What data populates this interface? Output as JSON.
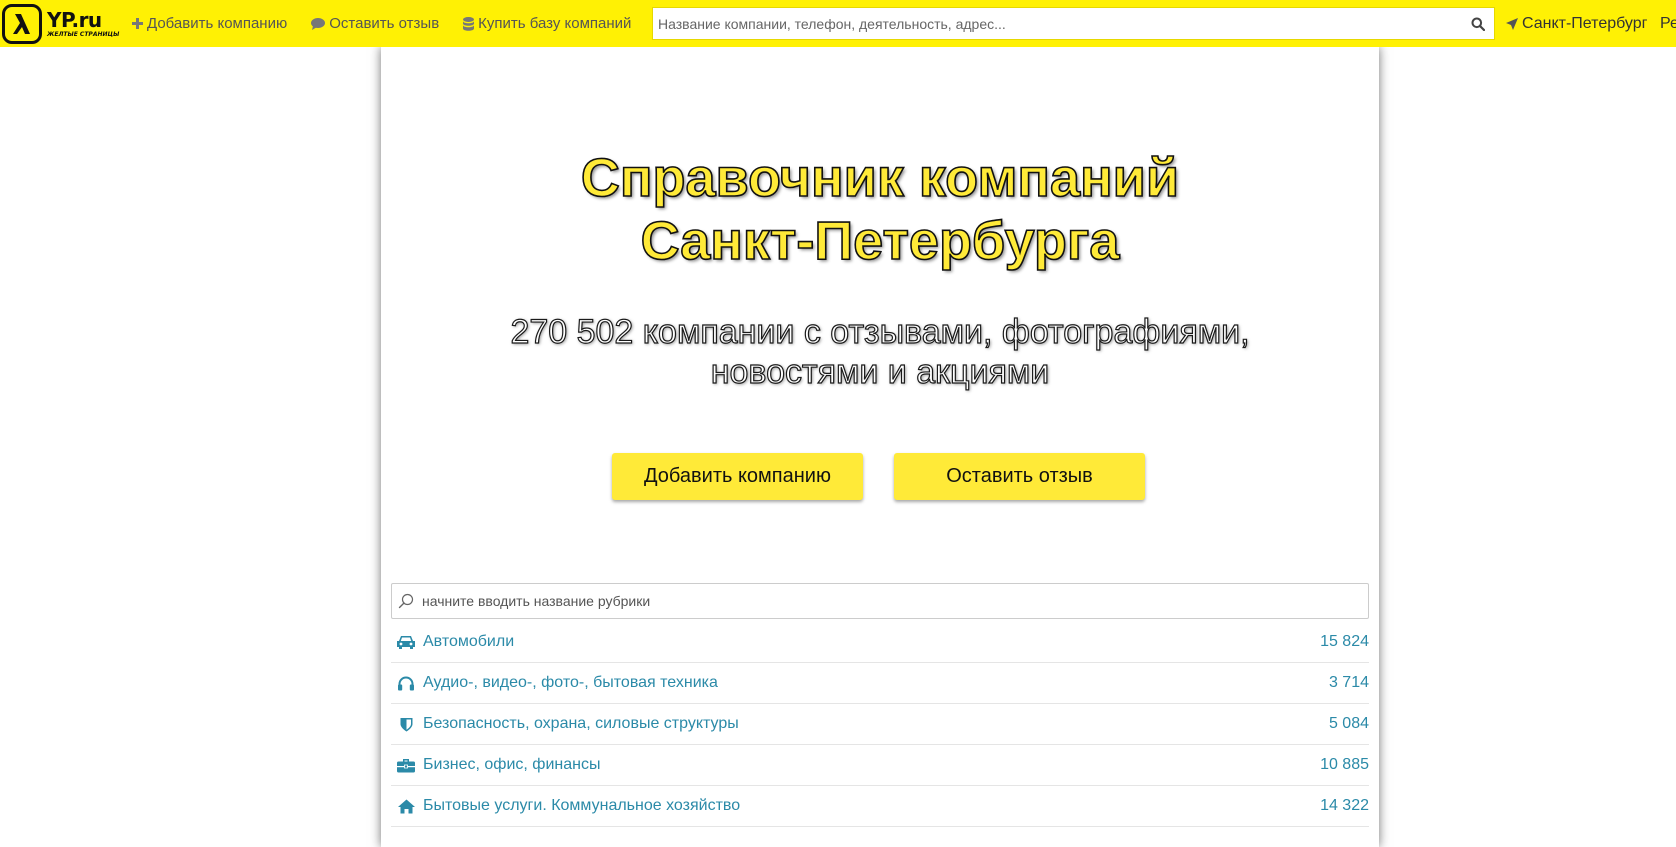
{
  "header": {
    "logo_name": "YP.ru",
    "logo_sub": "ЖЕЛТЫЕ СТРАНИЦЫ",
    "nav": [
      {
        "label": "Добавить компанию",
        "icon": "plus-icon"
      },
      {
        "label": "Оставить отзыв",
        "icon": "comment-icon"
      },
      {
        "label": "Купить базу компаний",
        "icon": "database-icon"
      }
    ],
    "search_placeholder": "Название компании, телефон, деятельность, адрес...",
    "city": "Санкт-Петербург",
    "region_cut": "Ре"
  },
  "hero": {
    "title_line1": "Справочник компаний",
    "title_line2": "Санкт-Петербурга",
    "subtitle_line1": "270 502 компании с отзывами, фотографиями,",
    "subtitle_line2": "новостями и акциями",
    "add_button": "Добавить компанию",
    "review_button": "Оставить отзыв"
  },
  "rubrics": {
    "search_placeholder": "начните вводить название рубрики",
    "items": [
      {
        "label": "Автомобили",
        "count": "15 824",
        "icon": "car-icon"
      },
      {
        "label": "Аудио-, видео-, фото-, бытовая техника",
        "count": "3 714",
        "icon": "headphones-icon"
      },
      {
        "label": "Безопасность, охрана, силовые структуры",
        "count": "5 084",
        "icon": "shield-icon"
      },
      {
        "label": "Бизнес, офис, финансы",
        "count": "10 885",
        "icon": "briefcase-icon"
      },
      {
        "label": "Бытовые услуги. Коммунальное хозяйство",
        "count": "14 322",
        "icon": "home-icon"
      }
    ]
  },
  "colors": {
    "brand_yellow": "#fff104",
    "button_yellow": "#ffea38",
    "link_blue": "#2b8aa8"
  }
}
